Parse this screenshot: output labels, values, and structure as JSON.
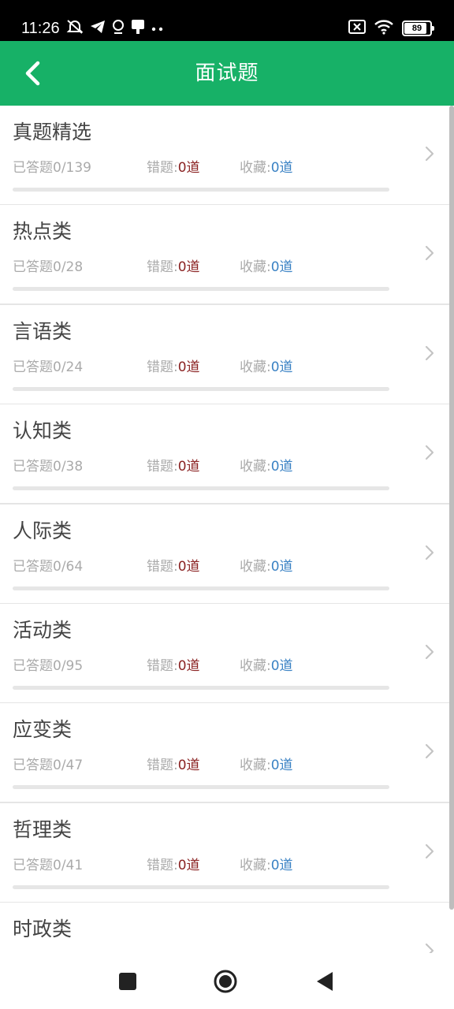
{
  "status_bar": {
    "time": "11:26",
    "icons_left": [
      "mute-icon",
      "telegram-icon",
      "location-icon",
      "notification-icon",
      "more-dots-icon"
    ],
    "icons_right": [
      "no-sim-icon",
      "wifi-icon"
    ],
    "battery": "89",
    "battery_level": 0.89
  },
  "header": {
    "title": "面试题",
    "back_icon": "chevron-left-icon"
  },
  "labels": {
    "answered_prefix": "已答题",
    "wrong_prefix": "错题:",
    "fav_prefix": "收藏:"
  },
  "categories": [
    {
      "title": "真题精选",
      "answered": "0/139",
      "wrong": "0道",
      "fav": "0道",
      "progress": 0
    },
    {
      "title": "热点类",
      "answered": "0/28",
      "wrong": "0道",
      "fav": "0道",
      "progress": 0
    },
    {
      "title": "言语类",
      "answered": "0/24",
      "wrong": "0道",
      "fav": "0道",
      "progress": 0
    },
    {
      "title": "认知类",
      "answered": "0/38",
      "wrong": "0道",
      "fav": "0道",
      "progress": 0
    },
    {
      "title": "人际类",
      "answered": "0/64",
      "wrong": "0道",
      "fav": "0道",
      "progress": 0
    },
    {
      "title": "活动类",
      "answered": "0/95",
      "wrong": "0道",
      "fav": "0道",
      "progress": 0
    },
    {
      "title": "应变类",
      "answered": "0/47",
      "wrong": "0道",
      "fav": "0道",
      "progress": 0
    },
    {
      "title": "哲理类",
      "answered": "0/41",
      "wrong": "0道",
      "fav": "0道",
      "progress": 0
    },
    {
      "title": "时政类"
    }
  ],
  "nav": {
    "icons": [
      "recent-apps-icon",
      "home-icon",
      "back-icon"
    ]
  },
  "colors": {
    "accent": "#17b167",
    "wrong_value": "#8b2323",
    "fav_value": "#3a82c4"
  }
}
